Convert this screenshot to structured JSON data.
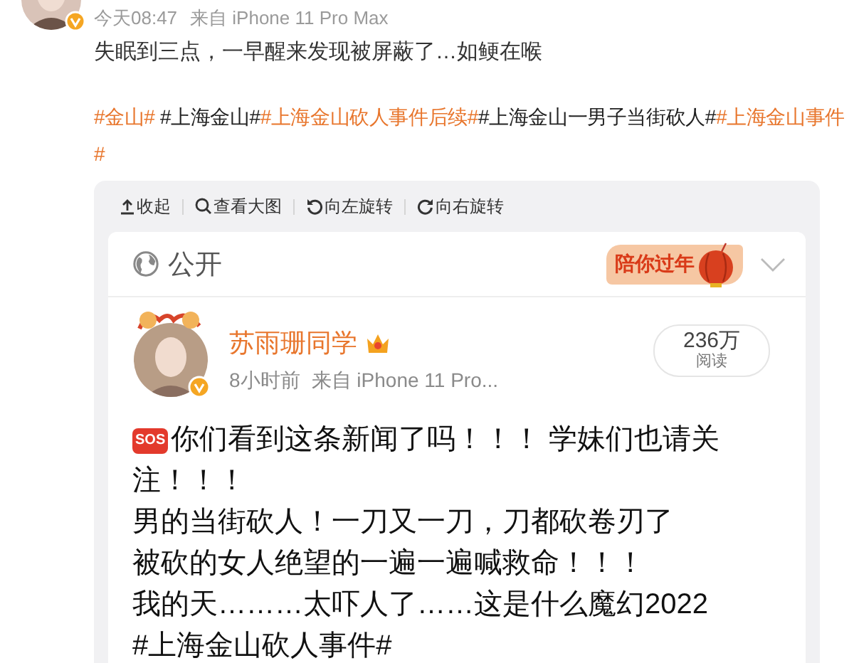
{
  "post": {
    "meta": [
      "今天08:47",
      "来自 iPhone 11 Pro Max"
    ],
    "text": "失眠到三点，一早醒来发现被屏蔽了…如鲠在喉",
    "hashtag_lines": [
      [
        {
          "text": "#金山#",
          "linked": true
        },
        {
          "text": " #上海金山#",
          "linked": false
        },
        {
          "text": "#上海金山砍人事件后续#",
          "linked": true
        },
        {
          "text": "#上海金山一男子当街砍人#",
          "linked": false
        },
        {
          "text": "#上海金山事件",
          "linked": true
        }
      ],
      [
        {
          "text": "#",
          "linked": true
        }
      ]
    ]
  },
  "image_viewer": {
    "toolbar": [
      {
        "kind": "collapse",
        "label": "收起"
      },
      {
        "kind": "zoom",
        "label": "查看大图"
      },
      {
        "kind": "rotate-left",
        "label": "向左旋转"
      },
      {
        "kind": "rotate-right",
        "label": "向右旋转"
      }
    ],
    "screenshot": {
      "visibility": "公开",
      "banner": "陪你过年",
      "author": "苏雨珊同学",
      "time": "8小时前",
      "source": "来自 iPhone 11 Pro...",
      "reads": "236万",
      "reads_label": "阅读",
      "body_lines": [
        {
          "kind": "sos",
          "badge": "SOS",
          "text": "你们看到这条新闻了吗！！！ 学妹们也请关"
        },
        {
          "kind": "text",
          "text": "注！！！"
        },
        {
          "kind": "text",
          "text": "男的当街砍人！一刀又一刀，刀都砍卷刃了"
        },
        {
          "kind": "text",
          "text": "被砍的女人绝望的一遍一遍喊救命！！！"
        },
        {
          "kind": "text",
          "text": "我的天………太吓人了……这是什么魔幻2022"
        },
        {
          "kind": "text",
          "text": "#上海金山砍人事件#"
        }
      ]
    }
  }
}
